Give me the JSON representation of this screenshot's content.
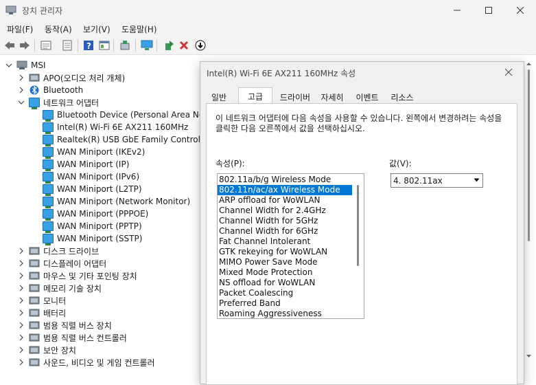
{
  "window": {
    "title": "장치 관리자"
  },
  "menu": [
    "파일(F)",
    "동작(A)",
    "보기(V)",
    "도움말(H)"
  ],
  "toolbar": {
    "buttons": [
      "back-icon",
      "forward-icon",
      "properties-icon",
      "list-icon",
      "help-icon",
      "view-icon",
      "scan-hardware-icon",
      "monitor-icon",
      "update-driver-icon",
      "uninstall-icon",
      "disable-icon"
    ]
  },
  "tree": {
    "root": "MSI",
    "categories": [
      "APO(오디오 처리 개체)",
      "Bluetooth",
      "네트워크 어댑터",
      "디스크 드라이브",
      "디스플레이 어댑터",
      "마우스 및 기타 포인팅 장치",
      "메모리 기술 장치",
      "모니터",
      "배터리",
      "범용 직렬 버스 장치",
      "범용 직렬 버스 컨트롤러",
      "보안 장치",
      "사운드, 비디오 및 게임 컨트롤러"
    ],
    "network_children": [
      "Bluetooth Device (Personal Area Netwo",
      "Intel(R) Wi-Fi 6E AX211 160MHz",
      "Realtek(R) USB GbE Family Controller",
      "WAN Miniport (IKEv2)",
      "WAN Miniport (IP)",
      "WAN Miniport (IPv6)",
      "WAN Miniport (L2TP)",
      "WAN Miniport (Network Monitor)",
      "WAN Miniport (PPPOE)",
      "WAN Miniport (PPTP)",
      "WAN Miniport (SSTP)"
    ]
  },
  "dialog": {
    "title": "Intel(R) Wi-Fi 6E AX211 160MHz 속성",
    "tabs": [
      "일반",
      "고급",
      "드라이버",
      "자세히",
      "이벤트",
      "리소스"
    ],
    "active_tab": "고급",
    "description": "이 네트워크 어댑터에 다음 속성을 사용할 수 있습니다. 왼쪽에서 변경하려는 속성을 클릭한 다음 오른쪽에서 값을 선택하십시오.",
    "property_label": "속성(P):",
    "value_label": "값(V):",
    "properties": [
      "802.11a/b/g Wireless Mode",
      "802.11n/ac/ax Wireless Mode",
      "ARP offload for WoWLAN",
      "Channel Width for 2.4GHz",
      "Channel Width for 5GHz",
      "Channel Width for 6GHz",
      "Fat Channel Intolerant",
      "GTK rekeying for WoWLAN",
      "MIMO Power Save Mode",
      "Mixed Mode Protection",
      "NS offload for WoWLAN",
      "Packet Coalescing",
      "Preferred Band",
      "Roaming Aggressiveness"
    ],
    "selected_property": "802.11n/ac/ax Wireless Mode",
    "value": "4. 802.11ax"
  },
  "colors": {
    "selection": "#0078d7",
    "delete_red": "#d13438",
    "accent_green": "#2b8a3e"
  }
}
